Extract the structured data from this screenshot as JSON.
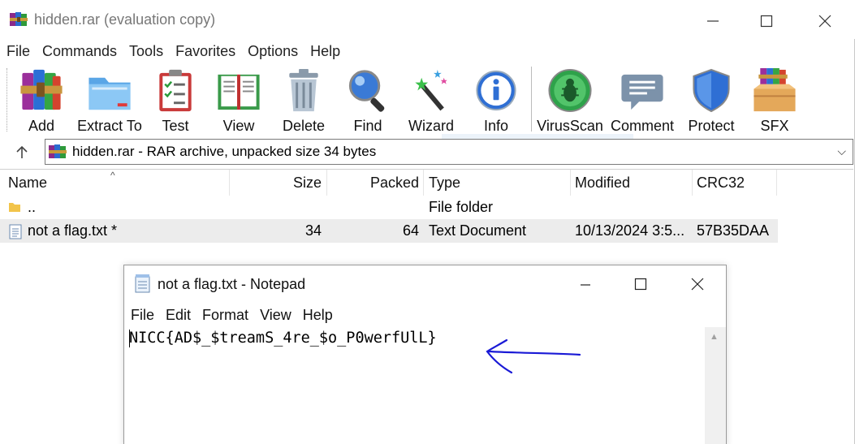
{
  "window": {
    "title": "hidden.rar (evaluation copy)"
  },
  "menu": [
    "File",
    "Commands",
    "Tools",
    "Favorites",
    "Options",
    "Help"
  ],
  "toolbar": {
    "buttons": [
      {
        "label": "Add",
        "icon": "books-stack-icon"
      },
      {
        "label": "Extract To",
        "icon": "folder-extract-icon"
      },
      {
        "label": "Test",
        "icon": "checklist-icon"
      },
      {
        "label": "View",
        "icon": "open-book-icon"
      },
      {
        "label": "Delete",
        "icon": "trash-can-icon"
      },
      {
        "label": "Find",
        "icon": "magnifier-icon"
      },
      {
        "label": "Wizard",
        "icon": "magic-wand-icon"
      },
      {
        "label": "Info",
        "icon": "info-icon"
      },
      {
        "label": "VirusScan",
        "icon": "bug-scan-icon"
      },
      {
        "label": "Comment",
        "icon": "speech-bubble-icon"
      },
      {
        "label": "Protect",
        "icon": "shield-icon"
      },
      {
        "label": "SFX",
        "icon": "sfx-box-icon"
      }
    ]
  },
  "address": {
    "text": "hidden.rar - RAR archive, unpacked size 34 bytes"
  },
  "filelist": {
    "headers": {
      "name": "Name",
      "size": "Size",
      "packed": "Packed",
      "type": "Type",
      "modified": "Modified",
      "crc": "CRC32"
    },
    "rows": [
      {
        "name": "..",
        "size": "",
        "packed": "",
        "type": "File folder",
        "modified": "",
        "crc": ""
      },
      {
        "name": "not a flag.txt *",
        "size": "34",
        "packed": "64",
        "type": "Text Document",
        "modified": "10/13/2024 3:5...",
        "crc": "57B35DAA"
      }
    ]
  },
  "notepad": {
    "title": "not a flag.txt - Notepad",
    "menu": [
      "File",
      "Edit",
      "Format",
      "View",
      "Help"
    ],
    "content": "NICC{AD$_$treamS_4re_$o_P0werfUlL}"
  },
  "colors": {
    "annotation_arrow": "#1a1ad6",
    "selected_row": "#ececec"
  }
}
